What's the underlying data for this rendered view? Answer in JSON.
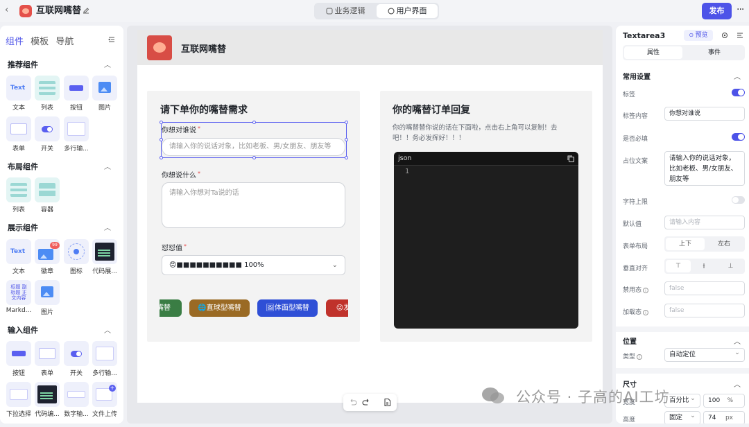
{
  "topbar": {
    "app_title": "互联网嘴替",
    "tabs": [
      {
        "label": "业务逻辑",
        "active": false
      },
      {
        "label": "用户界面",
        "active": true
      }
    ],
    "publish_label": "发布",
    "more_label": "···"
  },
  "left_panel": {
    "tabs": [
      "组件",
      "模板",
      "导航"
    ],
    "sections": {
      "recommended": {
        "title": "推荐组件",
        "items": [
          "文本",
          "列表",
          "按钮",
          "图片",
          "表单",
          "开关",
          "多行输..."
        ]
      },
      "layout": {
        "title": "布局组件",
        "items": [
          "列表",
          "容器"
        ]
      },
      "display": {
        "title": "展示组件",
        "items": [
          "文本",
          "徽章",
          "图标",
          "代码展...",
          "Markd...",
          "图片"
        ],
        "badge_count": "99",
        "text_thumb": "Text",
        "md_thumb": "标题 副标题 正文内容"
      },
      "input": {
        "title": "输入组件",
        "items": [
          "按钮",
          "表单",
          "开关",
          "多行输...",
          "下拉选择",
          "代码编...",
          "数字输...",
          "文件上传"
        ]
      }
    },
    "text_thumb": "Text"
  },
  "page": {
    "header_title": "互联网嘴替",
    "form_card": {
      "title": "请下单你的嘴替需求",
      "fields": [
        {
          "label": "你想对谁说",
          "placeholder": "请输入你的说话对象，比如老板、男/女朋友、朋友等"
        },
        {
          "label": "你想说什么",
          "placeholder": "请输入你想对Ta说的话"
        },
        {
          "label": "怼怼值",
          "value": "😡■■■■■■■■■■ 100%"
        }
      ],
      "chips": [
        {
          "label": "嘴替",
          "color": "#3a7d44"
        },
        {
          "label": "🌐直球型嘴替",
          "color": "#9a6a24"
        },
        {
          "label": "🖼体面型嘴替",
          "color": "#2f4fd6"
        },
        {
          "label": "😜发",
          "color": "#c0322b"
        }
      ]
    },
    "output_card": {
      "title": "你的嘴替订单回复",
      "description": "你的嘴替替你说的话在下面啦，点击右上角可以复制！去吧！！务必发挥好！！！",
      "code_lang": "json",
      "line_number": "1"
    }
  },
  "right_panel": {
    "component_name": "Textarea3",
    "preview_label": "预览",
    "tabs": [
      {
        "label": "属性",
        "active": true
      },
      {
        "label": "事件",
        "active": false
      }
    ],
    "common_section": "常用设置",
    "props": {
      "label_toggle": "标签",
      "label_content_label": "标签内容",
      "label_content_value": "你想对谁说",
      "required_label": "是否必填",
      "placeholder_label": "占位文案",
      "placeholder_value": "请输入你的说话对象，比如老板、男/女朋友、朋友等",
      "maxlen_label": "字符上限",
      "default_label": "默认值",
      "default_placeholder": "请输入内容",
      "form_layout_label": "表单布局",
      "form_layout_options": [
        "上下",
        "左右"
      ],
      "valign_label": "垂直对齐",
      "disabled_label": "禁用态",
      "disabled_value": "false",
      "loading_label": "加载态",
      "loading_value": "false"
    },
    "position_section": "位置",
    "position_type_label": "类型",
    "position_type_value": "自动定位",
    "size_section": "尺寸",
    "width_label": "宽度",
    "width_mode": "百分比",
    "width_value": "100",
    "width_unit": "%",
    "height_label": "高度",
    "height_mode": "固定",
    "height_value": "74",
    "height_unit": "px"
  },
  "watermark": "公众号 · 子高的AI工坊",
  "colors": {
    "accent": "#4d53e8",
    "code_bg": "#1e1e1e"
  }
}
